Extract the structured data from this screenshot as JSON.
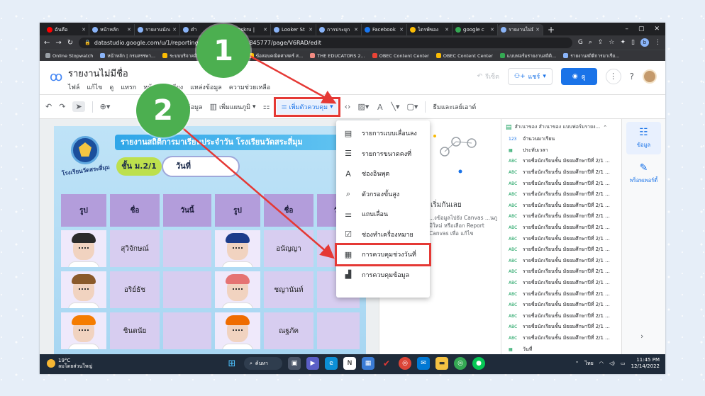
{
  "browser": {
    "tabs": [
      {
        "label": "ฉันคือ",
        "color": "#ff0000"
      },
      {
        "label": "หน้าหลัก",
        "color": "#8ab4f8"
      },
      {
        "label": "รายงานนักเรี",
        "color": "#8ab4f8"
      },
      {
        "label": "ดำ",
        "color": "#8ab4f8"
      },
      {
        "label": "Inskru |",
        "color": "#f28b82"
      },
      {
        "label": "Looker St",
        "color": "#8ab4f8"
      },
      {
        "label": "การประยุก",
        "color": "#8ab4f8"
      },
      {
        "label": "Facebook",
        "color": "#1877f2"
      },
      {
        "label": "ไดรฟ์ของ",
        "color": "#fbbc04"
      },
      {
        "label": "google c",
        "color": "#34a853"
      },
      {
        "label": "รายงานไม่มีช",
        "color": "#8ab4f8",
        "active": true
      }
    ],
    "url": "datastudio.google.com/u/1/reporting/b...5b95d-05e9f1845777/page/V6RAD/edit",
    "bookmarks": [
      {
        "label": "Online Stopwatch",
        "color": "#9aa0a6"
      },
      {
        "label": "หน้าหลัก | กรมสรรพา...",
        "color": "#8ab4f8"
      },
      {
        "label": "ระบบบริจาคอิเล็กท...",
        "color": "#fbbc04"
      },
      {
        "label": "BY BLE",
        "color": "#f28b82"
      },
      {
        "label": "ข้อสอบคณิตศาสตร์ ส...",
        "color": "#fbbc04"
      },
      {
        "label": "THE EDUCATORS 2...",
        "color": "#f28b82"
      },
      {
        "label": "OBEC Content Center",
        "color": "#ea4335"
      },
      {
        "label": "OBEC Content Center",
        "color": "#fbbc04"
      },
      {
        "label": "แบบฟอร์มรายงานสถิติ...",
        "color": "#34a853"
      },
      {
        "label": "รายงานสถิติการมาเรีย...",
        "color": "#8ab4f8"
      }
    ],
    "window_controls": {
      "minimize": "–",
      "maximize": "▢",
      "close": "✕"
    },
    "profile_initial": "b"
  },
  "app": {
    "title": "รายงานไม่มีชื่อ",
    "menu": [
      "ไฟล์",
      "แก้ไข",
      "ดู",
      "แทรก",
      "หน้า",
      "จัดเรียง",
      "แหล่งข้อมูล",
      "ความช่วยเหลือ"
    ],
    "reset_label": "รีเซ็ต",
    "share_label": "แชร์",
    "view_label": "ดู"
  },
  "toolbar": {
    "add_data_label": "เพิ่มข้อมูล",
    "add_chart_label": "เพิ่มแผนภูมิ",
    "add_control_label": "เพิ่มตัวควบคุม",
    "theme_label": "ธีมและเลย์เอาต์"
  },
  "control_menu": {
    "items": [
      {
        "label": "รายการแบบเลื่อนลง",
        "icon": "dropdown-list-icon",
        "glyph": "▤"
      },
      {
        "label": "รายการขนาดคงที่",
        "icon": "fixed-list-icon",
        "glyph": "☰"
      },
      {
        "label": "ช่องอินพุต",
        "icon": "input-box-icon",
        "glyph": "A"
      },
      {
        "label": "ตัวกรองขั้นสูง",
        "icon": "advanced-filter-icon",
        "glyph": "⌕"
      },
      {
        "label": "แถบเลื่อน",
        "icon": "slider-icon",
        "glyph": "⚌"
      },
      {
        "label": "ช่องทำเครื่องหมาย",
        "icon": "checkbox-icon",
        "glyph": "☑"
      },
      {
        "label": "การควบคุมช่วงวันที่",
        "icon": "calendar-icon",
        "glyph": "▦",
        "highlighted": true
      },
      {
        "label": "การควบคุมข้อมูล",
        "icon": "data-control-icon",
        "glyph": "▟"
      }
    ]
  },
  "report": {
    "title": "รายงานสถิติการมาเรียนประจำวัน โรงเรียนวัดสระสี่มุม",
    "school_seal_text": "โรงเรียนวัดสระสี่มุม",
    "class_label": "ชั้น ม.2/1",
    "date_label": "วันที่",
    "headers": [
      "รูป",
      "ชื่อ",
      "วันนี้",
      "รูป",
      "ชื่อ",
      "วัน"
    ],
    "rows": [
      {
        "name1": "สุวิจักษณ์",
        "name2": "อนัญญา",
        "hair1": "#2b2b2b",
        "hair2": "#1d3c8a"
      },
      {
        "name1": "อริย์ธัช",
        "name2": "ชญานันท์",
        "hair1": "#8a5a2b",
        "hair2": "#e57373"
      },
      {
        "name1": "ชินดนัย",
        "name2": "ณฐภัค",
        "hair1": "#f57c00",
        "hair2": "#ef6c00"
      }
    ]
  },
  "properties_panel": {
    "empty_title": "เริ่มกันเลย",
    "empty_desc": "...งข้อมูลไปยัง Canvas ...นภูมิใหม่ หรือเลือก Report Canvas เพื่อ แก้ไข"
  },
  "data_panel": {
    "source_title": "สำเนาของ สำเนาของ แบบฟอร์มรายง...",
    "fields": [
      {
        "type": "123",
        "label": "จำนวนมาเรียน"
      },
      {
        "type": "date",
        "label": "ประทับเวลา"
      },
      {
        "type": "ABC",
        "label": "รายชื่อนักเรียนชั้น มัธยมศึกษาปีที่ 2/1 ..."
      },
      {
        "type": "ABC",
        "label": "รายชื่อนักเรียนชั้น มัธยมศึกษาปีที่ 2/1 ..."
      },
      {
        "type": "ABC",
        "label": "รายชื่อนักเรียนชั้น มัธยมศึกษาปีที่ 2/1 ..."
      },
      {
        "type": "ABC",
        "label": "รายชื่อนักเรียนชั้น มัธยมศึกษาปีที่ 2/1 ..."
      },
      {
        "type": "ABC",
        "label": "รายชื่อนักเรียนชั้น มัธยมศึกษาปีที่ 2/1 ..."
      },
      {
        "type": "ABC",
        "label": "รายชื่อนักเรียนชั้น มัธยมศึกษาปีที่ 2/1 ..."
      },
      {
        "type": "ABC",
        "label": "รายชื่อนักเรียนชั้น มัธยมศึกษาปีที่ 2/1 ..."
      },
      {
        "type": "ABC",
        "label": "รายชื่อนักเรียนชั้น มัธยมศึกษาปีที่ 2/1 ..."
      },
      {
        "type": "ABC",
        "label": "รายชื่อนักเรียนชั้น มัธยมศึกษาปีที่ 2/1 ..."
      },
      {
        "type": "ABC",
        "label": "รายชื่อนักเรียนชั้น มัธยมศึกษาปีที่ 2/1 ..."
      },
      {
        "type": "ABC",
        "label": "รายชื่อนักเรียนชั้น มัธยมศึกษาปีที่ 2/1 ..."
      },
      {
        "type": "ABC",
        "label": "รายชื่อนักเรียนชั้น มัธยมศึกษาปีที่ 2/1 ..."
      },
      {
        "type": "ABC",
        "label": "รายชื่อนักเรียนชั้น มัธยมศึกษาปีที่ 2/1 ..."
      },
      {
        "type": "ABC",
        "label": "รายชื่อนักเรียนชั้น มัธยมศึกษาปีที่ 2/1 ..."
      },
      {
        "type": "ABC",
        "label": "รายชื่อนักเรียนชั้น มัธยมศึกษาปีที่ 2/1 ..."
      },
      {
        "type": "ABC",
        "label": "รายชื่อนักเรียนชั้น มัธยมศึกษาปีที่ 2/1 ..."
      },
      {
        "type": "ABC",
        "label": "รายชื่อนักเรียนชั้น มัธยมศึกษาปีที่ 2/1 ..."
      },
      {
        "type": "date",
        "label": "วันที่"
      }
    ]
  },
  "side_tabs": {
    "data_label": "ข้อมูล",
    "properties_label": "พร็อพเพอร์ตี้"
  },
  "taskbar": {
    "temp": "19°C",
    "weather_desc": "ลมโดยส่วนใหญ่",
    "search_label": "ค้นหา",
    "lang": "ไทย",
    "time": "11:45 PM",
    "date": "12/14/2022"
  },
  "annotations": {
    "step1": "1",
    "step2": "2"
  },
  "colors": {
    "accent": "#1a73e8",
    "highlight": "#e53935",
    "step_badge": "#4caf50"
  }
}
